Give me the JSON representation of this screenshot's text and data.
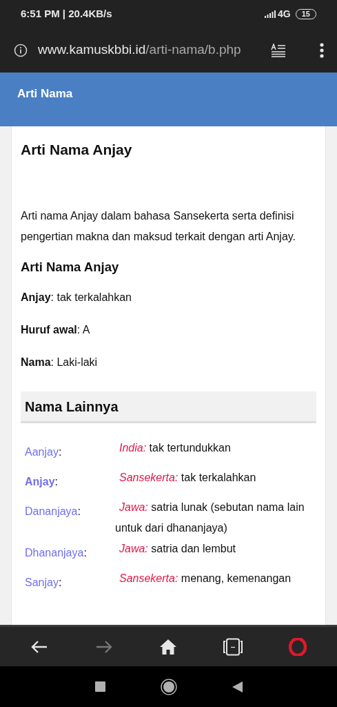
{
  "status_bar": {
    "time_speed": "6:51 PM | 20.4KB/s",
    "network": "4G",
    "battery": "15"
  },
  "url_bar": {
    "domain": "www.kamuskbbi.id",
    "path": "/arti-nama/b.php"
  },
  "header": {
    "title": "Arti Nama"
  },
  "article": {
    "title": "Arti Nama Anjay",
    "intro": "Arti nama Anjay dalam bahasa Sansekerta serta definisi pengertian makna dan maksud terkait dengan arti Anjay.",
    "subtitle": "Arti Nama Anjay",
    "fields": [
      {
        "label": "Anjay",
        "value": ": tak terkalahkan"
      },
      {
        "label": "Huruf awal",
        "value": ": A"
      },
      {
        "label": "Nama",
        "value": ": Laki-laki"
      }
    ]
  },
  "other_names": {
    "title": "Nama Lainnya",
    "rows": [
      {
        "name": "Aanjay",
        "suffix": ":",
        "selected": false,
        "language": "India:",
        "meaning": "tak tertundukkan"
      },
      {
        "name": "Anjay",
        "suffix": ":",
        "selected": true,
        "language": "Sansekerta:",
        "meaning": "tak terkalahkan"
      },
      {
        "name": "Dananjaya",
        "suffix": ":",
        "selected": false,
        "language": "Jawa:",
        "meaning": "satria lunak (sebutan nama lain untuk dari dhananjaya)"
      },
      {
        "name": "Dhananjaya",
        "suffix": ":",
        "selected": false,
        "language": "Jawa:",
        "meaning": "satria dan lembut"
      },
      {
        "name": "Sanjay",
        "suffix": ":",
        "selected": false,
        "language": "Sansekerta:",
        "meaning": "menang, kemenangan"
      }
    ]
  },
  "browser_nav": [
    {
      "kind": "back",
      "disabled": false
    },
    {
      "kind": "forward",
      "disabled": true
    },
    {
      "kind": "home",
      "disabled": false
    },
    {
      "kind": "tabs",
      "disabled": false
    },
    {
      "kind": "opera",
      "disabled": false
    }
  ]
}
